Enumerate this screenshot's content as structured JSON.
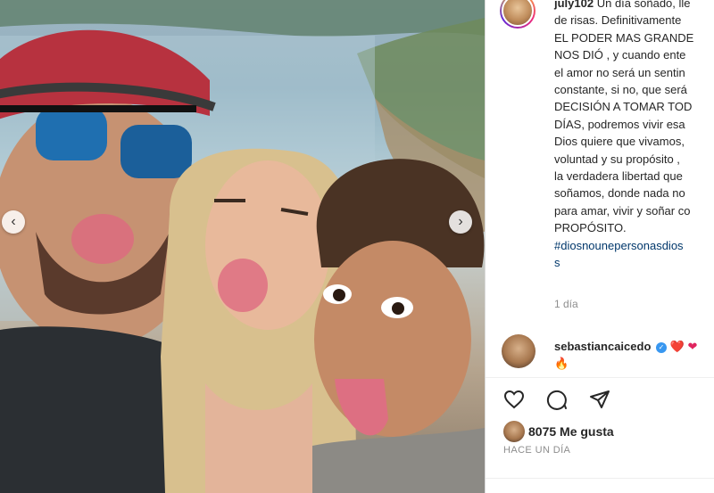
{
  "post": {
    "username": "july102",
    "caption_lines": [
      "Un día soñado, lle",
      "de risas. Definitivamente",
      "EL PODER MAS GRANDE",
      "NOS DIÓ , y cuando ente",
      "el amor no será un sentin",
      "constante, si no, que será",
      "DECISIÓN A TOMAR TOD",
      "DÍAS, podremos vivir esa",
      "Dios quiere que vivamos,",
      "voluntad y su propósito ,",
      "la verdadera libertad que",
      "soñamos, donde nada no",
      "para amar, vivir y soñar co",
      "PROPÓSITO."
    ],
    "hashtag_line1": "#diosnounepersonasdios",
    "hashtag_line2": "s",
    "time": "1 día"
  },
  "comment": {
    "username": "sebastiancaicedo",
    "emoji_inline": "❤️ ❤",
    "emoji_next": "🔥"
  },
  "likes": {
    "count_text": "8075 Me gusta",
    "ago": "HACE UN DÍA"
  },
  "icons": {
    "like": "heart-icon",
    "comment": "comment-icon",
    "share": "send-icon",
    "verified": "verified-icon"
  },
  "colors": {
    "link": "#00376b",
    "verified": "#3897f0",
    "muted": "#8e8e8e"
  }
}
